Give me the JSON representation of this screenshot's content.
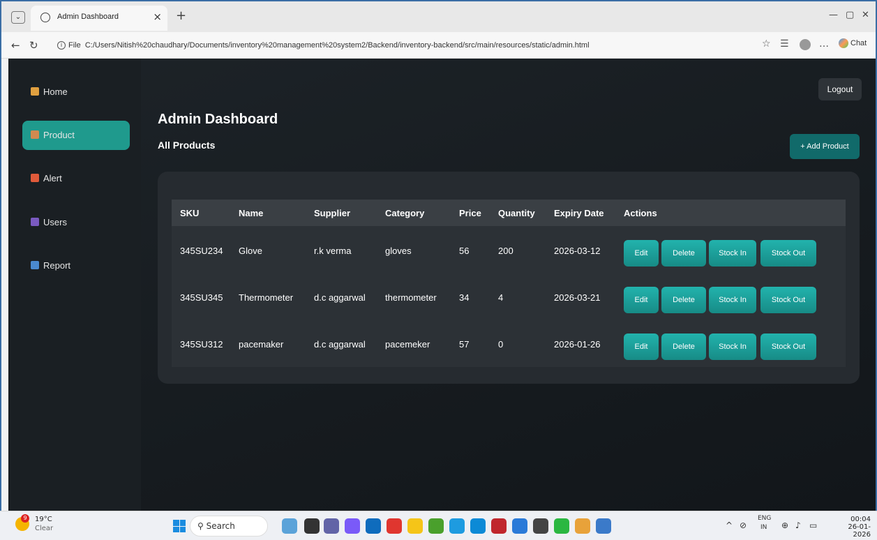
{
  "browser": {
    "tab_title": "Admin Dashboard",
    "address": "C:/Users/Nitish%20chaudhary/Documents/inventory%20management%20system2/Backend/inventory-backend/src/main/resources/static/admin.html",
    "file_label": "File",
    "chat_label": "Chat"
  },
  "sidebar": {
    "items": [
      {
        "label": "Home",
        "icon": "house-icon"
      },
      {
        "label": "Product",
        "icon": "box-icon"
      },
      {
        "label": "Alert",
        "icon": "siren-icon"
      },
      {
        "label": "Users",
        "icon": "user-icon"
      },
      {
        "label": "Report",
        "icon": "chart-icon"
      }
    ],
    "active": "Product"
  },
  "header": {
    "title": "Admin Dashboard",
    "subtitle": "All Products",
    "logout_label": "Logout",
    "add_label": "+ Add Product"
  },
  "table": {
    "columns": [
      "SKU",
      "Name",
      "Supplier",
      "Category",
      "Price",
      "Quantity",
      "Expiry Date",
      "Actions"
    ],
    "rows": [
      {
        "sku": "345SU234",
        "name": "Glove",
        "supplier": "r.k verma",
        "category": "gloves",
        "price": "56",
        "quantity": "200",
        "expiry": "2026-03-12"
      },
      {
        "sku": "345SU345",
        "name": "Thermometer",
        "supplier": "d.c aggarwal",
        "category": "thermometer",
        "price": "34",
        "quantity": "4",
        "expiry": "2026-03-21"
      },
      {
        "sku": "345SU312",
        "name": "pacemaker",
        "supplier": "d.c aggarwal",
        "category": "pacemeker",
        "price": "57",
        "quantity": "0",
        "expiry": "2026-01-26"
      }
    ],
    "actions": {
      "edit": "Edit",
      "delete": "Delete",
      "stock_in": "Stock In",
      "stock_out": "Stock Out"
    }
  },
  "taskbar": {
    "temp": "19°C",
    "weather": "Clear",
    "search": "Search",
    "lang": "ENG",
    "region": "IN",
    "time": "00:04",
    "date": "26-01-2026"
  },
  "colors": {
    "accent": "#1f9a8d",
    "button": "#178b86",
    "background": "#161b1f"
  }
}
